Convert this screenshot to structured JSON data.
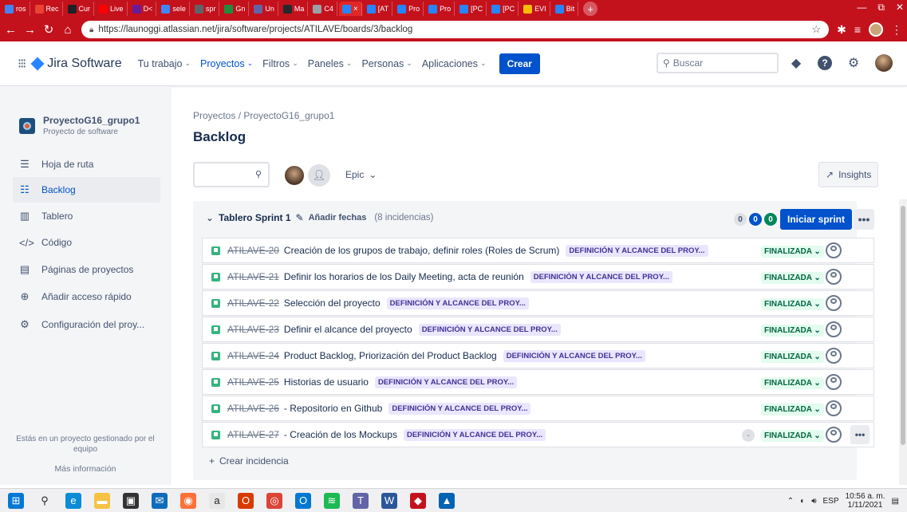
{
  "browser": {
    "tabs": [
      {
        "label": "ros",
        "color": "#4285f4"
      },
      {
        "label": "Rec",
        "color": "#ea4335"
      },
      {
        "label": "Cur",
        "color": "#202124"
      },
      {
        "label": "Live",
        "color": "#ff0000"
      },
      {
        "label": "D<",
        "color": "#6a1b9a"
      },
      {
        "label": "sele",
        "color": "#4285f4"
      },
      {
        "label": "spr",
        "color": "#5f6368"
      },
      {
        "label": "Gn",
        "color": "#1e8e3e"
      },
      {
        "label": "Un",
        "color": "#6264a7"
      },
      {
        "label": "Ma",
        "color": "#24292e"
      },
      {
        "label": "C4",
        "color": "#9aa0a6"
      }
    ],
    "active_tab": {
      "label": "",
      "close": "×"
    },
    "right_tabs": [
      {
        "label": "[AT",
        "color": "#2684ff"
      },
      {
        "label": "Pro",
        "color": "#2684ff"
      },
      {
        "label": "Pro",
        "color": "#2684ff"
      },
      {
        "label": "[PC",
        "color": "#2684ff"
      },
      {
        "label": "[PC",
        "color": "#2684ff"
      },
      {
        "label": "EVI",
        "color": "#fbbc04"
      },
      {
        "label": "Bit",
        "color": "#2684ff"
      }
    ],
    "new_tab": "+",
    "window_controls": {
      "minimize": "—",
      "maximize": "⧉",
      "close": "✕"
    },
    "url": "https://launoggi.atlassian.net/jira/software/projects/ATILAVE/boards/3/backlog"
  },
  "jira": {
    "logo_text": "Jira Software",
    "nav": [
      {
        "label": "Tu trabajo",
        "selected": false
      },
      {
        "label": "Proyectos",
        "selected": true
      },
      {
        "label": "Filtros",
        "selected": false
      },
      {
        "label": "Paneles",
        "selected": false
      },
      {
        "label": "Personas",
        "selected": false
      },
      {
        "label": "Aplicaciones",
        "selected": false
      }
    ],
    "create_label": "Crear",
    "search_placeholder": "Buscar"
  },
  "sidebar": {
    "project_name": "ProyectoG16_grupo1",
    "project_type": "Proyecto de software",
    "items": [
      {
        "label": "Hoja de ruta",
        "icon": "roadmap-icon",
        "glyph": "☰",
        "active": false
      },
      {
        "label": "Backlog",
        "icon": "backlog-icon",
        "glyph": "☷",
        "active": true
      },
      {
        "label": "Tablero",
        "icon": "board-icon",
        "glyph": "▥",
        "active": false
      },
      {
        "label": "Código",
        "icon": "code-icon",
        "glyph": "</>",
        "active": false
      },
      {
        "label": "Páginas de proyectos",
        "icon": "pages-icon",
        "glyph": "▤",
        "active": false
      },
      {
        "label": "Añadir acceso rápido",
        "icon": "add-shortcut-icon",
        "glyph": "⊕",
        "active": false
      },
      {
        "label": "Configuración del proy...",
        "icon": "settings-icon",
        "glyph": "⚙",
        "active": false
      }
    ],
    "footer_text": "Estás en un proyecto gestionado por el equipo",
    "footer_link": "Más información"
  },
  "main": {
    "breadcrumb": "Proyectos  /  ProyectoG16_grupo1",
    "title": "Backlog",
    "epic_filter": "Epic",
    "insights_label": "Insights"
  },
  "sprint": {
    "name": "Tablero Sprint 1",
    "add_dates": "Añadir fechas",
    "issue_count": "(8 incidencias)",
    "counts": {
      "todo": "0",
      "in_progress": "0",
      "done": "0"
    },
    "start_label": "Iniciar sprint",
    "more": "•••",
    "issues": [
      {
        "key": "ATILAVE-20",
        "summary": "Creación de los grupos de trabajo, definir roles (Roles de Scrum)",
        "epic": "DEFINICIÓN Y ALCANCE DEL PROY...",
        "status": "FINALIZADA ⌄"
      },
      {
        "key": "ATILAVE-21",
        "summary": "Definir los horarios de los Daily Meeting, acta de reunión",
        "epic": "DEFINICIÓN Y ALCANCE DEL PROY...",
        "status": "FINALIZADA ⌄"
      },
      {
        "key": "ATILAVE-22",
        "summary": "Selección del proyecto",
        "epic": "DEFINICIÓN Y ALCANCE DEL PROY...",
        "status": "FINALIZADA ⌄"
      },
      {
        "key": "ATILAVE-23",
        "summary": "Definir el alcance del proyecto",
        "epic": "DEFINICIÓN Y ALCANCE DEL PROY...",
        "status": "FINALIZADA ⌄"
      },
      {
        "key": "ATILAVE-24",
        "summary": "Product Backlog, Priorización del Product Backlog",
        "epic": "DEFINICIÓN Y ALCANCE DEL PROY...",
        "status": "FINALIZADA ⌄"
      },
      {
        "key": "ATILAVE-25",
        "summary": "Historias de usuario",
        "epic": "DEFINICIÓN Y ALCANCE DEL PROY...",
        "status": "FINALIZADA ⌄"
      },
      {
        "key": "ATILAVE-26",
        "summary": "- Repositorio en Github",
        "epic": "DEFINICIÓN Y ALCANCE DEL PROY...",
        "status": "FINALIZADA ⌄"
      },
      {
        "key": "ATILAVE-27",
        "summary": "- Creación de los Mockups",
        "epic": "DEFINICIÓN Y ALCANCE DEL PROY...",
        "status": "FINALIZADA ⌄",
        "estimate": "-",
        "more": "•••"
      }
    ],
    "create_issue": "Crear incidencia"
  },
  "taskbar": {
    "apps": [
      {
        "name": "windows-start-icon",
        "color": "#0078d4",
        "glyph": "⊞"
      },
      {
        "name": "search-icon",
        "color": "#f0f0f3",
        "glyph": "⚲"
      },
      {
        "name": "edge-icon",
        "color": "#0c8bd6",
        "glyph": "e"
      },
      {
        "name": "file-explorer-icon",
        "color": "#f6c244",
        "glyph": "▬"
      },
      {
        "name": "store-icon",
        "color": "#333333",
        "glyph": "▣"
      },
      {
        "name": "mail-icon",
        "color": "#0f6cbd",
        "glyph": "✉"
      },
      {
        "name": "firefox-icon",
        "color": "#ff7139",
        "glyph": "◉"
      },
      {
        "name": "amazon-icon",
        "color": "#e7e7e7",
        "glyph": "a"
      },
      {
        "name": "office-icon",
        "color": "#d83b01",
        "glyph": "O"
      },
      {
        "name": "chrome-icon",
        "color": "#db4437",
        "glyph": "◎"
      },
      {
        "name": "outlook-icon",
        "color": "#0078d4",
        "glyph": "O"
      },
      {
        "name": "spotify-icon",
        "color": "#1db954",
        "glyph": "≋"
      },
      {
        "name": "teams-icon",
        "color": "#6264a7",
        "glyph": "T"
      },
      {
        "name": "word-icon",
        "color": "#2b579a",
        "glyph": "W"
      },
      {
        "name": "app-icon",
        "color": "#c4121d",
        "glyph": "◆"
      },
      {
        "name": "photos-icon",
        "color": "#0063b1",
        "glyph": "▲"
      }
    ],
    "language": "ESP",
    "time": "10:56 a. m.",
    "date": "1/11/2021"
  }
}
